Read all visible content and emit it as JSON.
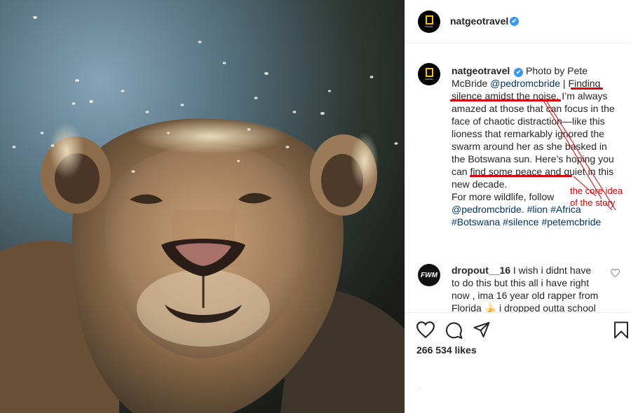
{
  "post": {
    "account": "natgeotravel",
    "verified_mark": "✔",
    "avatar_text": "TRAVEL",
    "caption": {
      "author": "natgeotravel",
      "segments": [
        {
          "text": "Photo by Pete McBride ",
          "type": "text"
        },
        {
          "text": "@pedromcbride",
          "type": "link"
        },
        {
          "text": " | Finding silence amidst the noise. I’m always amazed at those that can focus in the face of chaotic distraction—like this lioness that remarkably ignored the swarm around her as she basked in the Botswana sun. Here’s hoping you can find some peace and quiet in this new decade.",
          "type": "text"
        },
        {
          "text": "For more wildlife, follow ",
          "type": "text",
          "newline": true
        },
        {
          "text": "@pedromcbride",
          "type": "link"
        },
        {
          "text": ". ",
          "type": "text"
        },
        {
          "text": "#lion",
          "type": "link"
        },
        {
          "text": " ",
          "type": "text"
        },
        {
          "text": "#Africa",
          "type": "link"
        },
        {
          "text": " ",
          "type": "text"
        },
        {
          "text": "#Botswana",
          "type": "link"
        },
        {
          "text": " ",
          "type": "text"
        },
        {
          "text": "#silence",
          "type": "link"
        },
        {
          "text": " ",
          "type": "text"
        },
        {
          "text": "#petemcbride",
          "type": "link"
        }
      ]
    },
    "annotation": {
      "text_line1": "the core idea",
      "text_line2": "of the story",
      "color": "#e00000"
    },
    "comment": {
      "author": "dropout__16",
      "avatar_text": "FWM",
      "text": "I wish i didnt have to do this but this all i have right now , ima 16 year old rapper from Florida 🍌 i dropped outta school"
    },
    "actions": {
      "like_icon": "heart-icon",
      "comment_icon": "comment-icon",
      "share_icon": "send-icon",
      "save_icon": "bookmark-icon"
    },
    "likes": "266 534 likes",
    "footer_mark": "."
  },
  "colors": {
    "link": "#00376b",
    "verified": "#3897f0",
    "brand_yellow": "#f5c400"
  }
}
